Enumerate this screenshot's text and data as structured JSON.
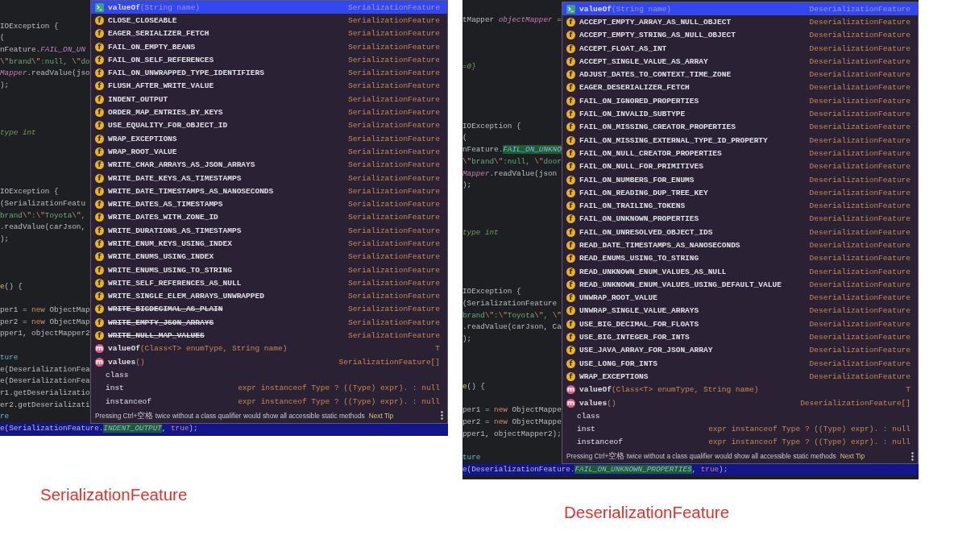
{
  "panels": [
    {
      "editor_lines": [
        {
          "kind": "code",
          "segments": [
            {
              "kind": "plain",
              "text": "IOException {"
            }
          ]
        },
        {
          "kind": "code",
          "segments": [
            {
              "kind": "plain",
              "text": "("
            }
          ]
        },
        {
          "kind": "code",
          "segments": [
            {
              "kind": "plain",
              "text": "nFeature."
            },
            {
              "kind": "field",
              "text": "FAIL_ON_UN"
            }
          ]
        },
        {
          "kind": "code",
          "segments": [
            {
              "kind": "escape",
              "text": "\\\""
            },
            {
              "kind": "string",
              "text": "brand"
            },
            {
              "kind": "escape",
              "text": "\\\""
            },
            {
              "kind": "string",
              "text": ":null, "
            },
            {
              "kind": "escape",
              "text": "\\\""
            },
            {
              "kind": "string",
              "text": "do"
            }
          ]
        },
        {
          "kind": "code",
          "segments": [
            {
              "kind": "field",
              "text": "Mapper"
            },
            {
              "kind": "plain",
              "text": ".readValue(jso"
            }
          ]
        },
        {
          "kind": "code",
          "segments": [
            {
              "kind": "plain",
              "text": ");"
            }
          ]
        },
        {
          "kind": "blank"
        },
        {
          "kind": "blank"
        },
        {
          "kind": "blank"
        },
        {
          "kind": "code",
          "segments": [
            {
              "kind": "comment",
              "text": "type int"
            }
          ]
        },
        {
          "kind": "blank"
        },
        {
          "kind": "blank"
        },
        {
          "kind": "blank"
        },
        {
          "kind": "blank"
        },
        {
          "kind": "code",
          "segments": [
            {
              "kind": "plain",
              "text": "IOException {"
            }
          ]
        },
        {
          "kind": "code",
          "segments": [
            {
              "kind": "plain",
              "text": "(SerializationFeatu"
            }
          ]
        },
        {
          "kind": "code",
          "segments": [
            {
              "kind": "string",
              "text": "brand"
            },
            {
              "kind": "escape",
              "text": "\\\""
            },
            {
              "kind": "string",
              "text": ":"
            },
            {
              "kind": "escape",
              "text": "\\\""
            },
            {
              "kind": "string",
              "text": "Toyota"
            },
            {
              "kind": "escape",
              "text": "\\\""
            },
            {
              "kind": "string",
              "text": ","
            }
          ]
        },
        {
          "kind": "code",
          "segments": [
            {
              "kind": "plain",
              "text": ".readValue(carJson,"
            }
          ]
        },
        {
          "kind": "code",
          "segments": [
            {
              "kind": "plain",
              "text": ");"
            }
          ]
        },
        {
          "kind": "blank"
        },
        {
          "kind": "blank"
        },
        {
          "kind": "blank"
        },
        {
          "kind": "code",
          "segments": [
            {
              "kind": "method",
              "text": "e"
            },
            {
              "kind": "plain",
              "text": "() {"
            }
          ]
        },
        {
          "kind": "blank"
        },
        {
          "kind": "code",
          "segments": [
            {
              "kind": "plain",
              "text": "per1 = "
            },
            {
              "kind": "keyword",
              "text": "new"
            },
            {
              "kind": "plain",
              "text": " ObjectMap"
            }
          ]
        },
        {
          "kind": "code",
          "segments": [
            {
              "kind": "plain",
              "text": "per2 = "
            },
            {
              "kind": "keyword",
              "text": "new"
            },
            {
              "kind": "plain",
              "text": " ObjectMap"
            }
          ]
        },
        {
          "kind": "code",
          "segments": [
            {
              "kind": "plain",
              "text": "pper1, objectMapper2"
            }
          ]
        },
        {
          "kind": "blank"
        },
        {
          "kind": "code",
          "segments": [
            {
              "kind": "teal",
              "text": "ture"
            }
          ]
        },
        {
          "kind": "code",
          "segments": [
            {
              "kind": "plain",
              "text": "e(DeserializationFea"
            }
          ]
        },
        {
          "kind": "code",
          "segments": [
            {
              "kind": "plain",
              "text": "e(DeserializationFea"
            }
          ]
        },
        {
          "kind": "code",
          "segments": [
            {
              "kind": "plain",
              "text": "r1.getDeserializatio"
            }
          ]
        },
        {
          "kind": "code",
          "segments": [
            {
              "kind": "plain",
              "text": "er2.getDeserializati"
            }
          ]
        },
        {
          "kind": "code",
          "segments": [
            {
              "kind": "teal",
              "text": "re"
            }
          ]
        }
      ],
      "current_line": {
        "segments": [
          {
            "kind": "plain",
            "text": "e(SerializationFeature."
          },
          {
            "kind": "match",
            "text": "INDENT_OUTPUT"
          },
          {
            "kind": "plain",
            "text": ", "
          },
          {
            "kind": "keyword",
            "text": "true"
          },
          {
            "kind": "plain",
            "text": ");"
          }
        ]
      },
      "completion": {
        "items": [
          {
            "kind": "static-method",
            "name": "valueOf",
            "params": "(String name)",
            "type": "SerializationFeature",
            "selected": true,
            "deprecated": false
          },
          {
            "kind": "field",
            "icon": "f",
            "name": "CLOSE_CLOSEABLE",
            "type": "SerializationFeature",
            "selected": false,
            "deprecated": false
          },
          {
            "kind": "field",
            "icon": "f",
            "name": "EAGER_SERIALIZER_FETCH",
            "type": "SerializationFeature",
            "selected": false,
            "deprecated": false
          },
          {
            "kind": "field",
            "icon": "f",
            "name": "FAIL_ON_EMPTY_BEANS",
            "type": "SerializationFeature",
            "selected": false,
            "deprecated": false
          },
          {
            "kind": "field",
            "icon": "f",
            "name": "FAIL_ON_SELF_REFERENCES",
            "type": "SerializationFeature",
            "selected": false,
            "deprecated": false
          },
          {
            "kind": "field",
            "icon": "f",
            "name": "FAIL_ON_UNWRAPPED_TYPE_IDENTIFIERS",
            "type": "SerializationFeature",
            "selected": false,
            "deprecated": false
          },
          {
            "kind": "field",
            "icon": "f",
            "name": "FLUSH_AFTER_WRITE_VALUE",
            "type": "SerializationFeature",
            "selected": false,
            "deprecated": false
          },
          {
            "kind": "field",
            "icon": "f",
            "name": "INDENT_OUTPUT",
            "type": "SerializationFeature",
            "selected": false,
            "deprecated": false
          },
          {
            "kind": "field",
            "icon": "f",
            "name": "ORDER_MAP_ENTRIES_BY_KEYS",
            "type": "SerializationFeature",
            "selected": false,
            "deprecated": false
          },
          {
            "kind": "field",
            "icon": "f",
            "name": "USE_EQUALITY_FOR_OBJECT_ID",
            "type": "SerializationFeature",
            "selected": false,
            "deprecated": false
          },
          {
            "kind": "field",
            "icon": "f",
            "name": "WRAP_EXCEPTIONS",
            "type": "SerializationFeature",
            "selected": false,
            "deprecated": false
          },
          {
            "kind": "field",
            "icon": "f",
            "name": "WRAP_ROOT_VALUE",
            "type": "SerializationFeature",
            "selected": false,
            "deprecated": false
          },
          {
            "kind": "field",
            "icon": "f",
            "name": "WRITE_CHAR_ARRAYS_AS_JSON_ARRAYS",
            "type": "SerializationFeature",
            "selected": false,
            "deprecated": false
          },
          {
            "kind": "field",
            "icon": "f",
            "name": "WRITE_DATE_KEYS_AS_TIMESTAMPS",
            "type": "SerializationFeature",
            "selected": false,
            "deprecated": false
          },
          {
            "kind": "field",
            "icon": "f",
            "name": "WRITE_DATE_TIMESTAMPS_AS_NANOSECONDS",
            "type": "SerializationFeature",
            "selected": false,
            "deprecated": false
          },
          {
            "kind": "field",
            "icon": "f",
            "name": "WRITE_DATES_AS_TIMESTAMPS",
            "type": "SerializationFeature",
            "selected": false,
            "deprecated": false
          },
          {
            "kind": "field",
            "icon": "f",
            "name": "WRITE_DATES_WITH_ZONE_ID",
            "type": "SerializationFeature",
            "selected": false,
            "deprecated": false
          },
          {
            "kind": "field",
            "icon": "f",
            "name": "WRITE_DURATIONS_AS_TIMESTAMPS",
            "type": "SerializationFeature",
            "selected": false,
            "deprecated": false
          },
          {
            "kind": "field",
            "icon": "f",
            "name": "WRITE_ENUM_KEYS_USING_INDEX",
            "type": "SerializationFeature",
            "selected": false,
            "deprecated": false
          },
          {
            "kind": "field",
            "icon": "f",
            "name": "WRITE_ENUMS_USING_INDEX",
            "type": "SerializationFeature",
            "selected": false,
            "deprecated": false
          },
          {
            "kind": "field",
            "icon": "f",
            "name": "WRITE_ENUMS_USING_TO_STRING",
            "type": "SerializationFeature",
            "selected": false,
            "deprecated": false
          },
          {
            "kind": "field",
            "icon": "f",
            "name": "WRITE_SELF_REFERENCES_AS_NULL",
            "type": "SerializationFeature",
            "selected": false,
            "deprecated": false
          },
          {
            "kind": "field",
            "icon": "f",
            "name": "WRITE_SINGLE_ELEM_ARRAYS_UNWRAPPED",
            "type": "SerializationFeature",
            "selected": false,
            "deprecated": false
          },
          {
            "kind": "field",
            "icon": "f",
            "name": "WRITE_BIGDECIMAL_AS_PLAIN",
            "type": "SerializationFeature",
            "selected": false,
            "deprecated": true
          },
          {
            "kind": "field",
            "icon": "f",
            "name": "WRITE_EMPTY_JSON_ARRAYS",
            "type": "SerializationFeature",
            "selected": false,
            "deprecated": true
          },
          {
            "kind": "field",
            "icon": "f",
            "name": "WRITE_NULL_MAP_VALUES",
            "type": "SerializationFeature",
            "selected": false,
            "deprecated": true
          },
          {
            "kind": "method",
            "icon": "m",
            "name": "valueOf",
            "params": "(Class<T> enumType, String name)",
            "type": "T",
            "selected": false,
            "deprecated": false
          },
          {
            "kind": "method",
            "icon": "m",
            "name": "values",
            "params": "()",
            "type": "SerializationFeature[]",
            "selected": false,
            "deprecated": false
          },
          {
            "kind": "keyword",
            "name": "class",
            "selected": false,
            "deprecated": false
          },
          {
            "kind": "keyword",
            "name": "inst",
            "type": "expr instanceof Type ? ((Type) expr). : null",
            "selected": false,
            "deprecated": false
          },
          {
            "kind": "keyword",
            "name": "instanceof",
            "type": "expr instanceof Type ? ((Type) expr). : null",
            "selected": false,
            "deprecated": false
          }
        ],
        "hint": "Pressing Ctrl+空格 twice without a class qualifier would show all accessible static methods",
        "hint_link": "Next Tip"
      },
      "caption": "SerializationFeature"
    },
    {
      "editor_lines": [
        {
          "kind": "code",
          "segments": [
            {
              "kind": "plain",
              "text": "tMapper "
            },
            {
              "kind": "field",
              "text": "objectMapper"
            },
            {
              "kind": "plain",
              "text": " ="
            }
          ]
        },
        {
          "kind": "blank"
        },
        {
          "kind": "blank"
        },
        {
          "kind": "blank"
        },
        {
          "kind": "code",
          "segments": [
            {
              "kind": "comment",
              "text": "=0}"
            }
          ]
        },
        {
          "kind": "blank"
        },
        {
          "kind": "blank"
        },
        {
          "kind": "blank"
        },
        {
          "kind": "blank"
        },
        {
          "kind": "code",
          "segments": [
            {
              "kind": "plain",
              "text": "IOException {"
            }
          ]
        },
        {
          "kind": "code",
          "segments": [
            {
              "kind": "plain",
              "text": "("
            }
          ]
        },
        {
          "kind": "code",
          "segments": [
            {
              "kind": "plain",
              "text": "nFeature."
            },
            {
              "kind": "match",
              "text": "FAIL_ON_UNKNO"
            }
          ]
        },
        {
          "kind": "code",
          "segments": [
            {
              "kind": "escape",
              "text": "\\\""
            },
            {
              "kind": "string",
              "text": "brand"
            },
            {
              "kind": "escape",
              "text": "\\\""
            },
            {
              "kind": "string",
              "text": ":null, "
            },
            {
              "kind": "escape",
              "text": "\\\""
            },
            {
              "kind": "string",
              "text": "door"
            }
          ]
        },
        {
          "kind": "code",
          "segments": [
            {
              "kind": "field",
              "text": "Mapper"
            },
            {
              "kind": "plain",
              "text": ".readValue(json"
            }
          ]
        },
        {
          "kind": "code",
          "segments": [
            {
              "kind": "plain",
              "text": ");"
            }
          ]
        },
        {
          "kind": "blank"
        },
        {
          "kind": "blank"
        },
        {
          "kind": "blank"
        },
        {
          "kind": "code",
          "segments": [
            {
              "kind": "comment",
              "text": "type int"
            }
          ]
        },
        {
          "kind": "blank"
        },
        {
          "kind": "blank"
        },
        {
          "kind": "blank"
        },
        {
          "kind": "blank"
        },
        {
          "kind": "code",
          "segments": [
            {
              "kind": "plain",
              "text": "IOException {"
            }
          ]
        },
        {
          "kind": "code",
          "segments": [
            {
              "kind": "plain",
              "text": "(SerializationFeature"
            }
          ]
        },
        {
          "kind": "code",
          "segments": [
            {
              "kind": "string",
              "text": "brand"
            },
            {
              "kind": "escape",
              "text": "\\\""
            },
            {
              "kind": "string",
              "text": ":"
            },
            {
              "kind": "escape",
              "text": "\\\""
            },
            {
              "kind": "string",
              "text": "Toyota"
            },
            {
              "kind": "escape",
              "text": "\\\""
            },
            {
              "kind": "string",
              "text": ", "
            },
            {
              "kind": "escape",
              "text": "\\\""
            }
          ]
        },
        {
          "kind": "code",
          "segments": [
            {
              "kind": "plain",
              "text": ".readValue(carJson, Ca"
            }
          ]
        },
        {
          "kind": "code",
          "segments": [
            {
              "kind": "plain",
              "text": ");"
            }
          ]
        },
        {
          "kind": "blank"
        },
        {
          "kind": "blank"
        },
        {
          "kind": "blank"
        },
        {
          "kind": "code",
          "segments": [
            {
              "kind": "method",
              "text": "e"
            },
            {
              "kind": "plain",
              "text": "() {"
            }
          ]
        },
        {
          "kind": "blank"
        },
        {
          "kind": "code",
          "segments": [
            {
              "kind": "plain",
              "text": "per1 = "
            },
            {
              "kind": "keyword",
              "text": "new"
            },
            {
              "kind": "plain",
              "text": " ObjectMappe"
            }
          ]
        },
        {
          "kind": "code",
          "segments": [
            {
              "kind": "plain",
              "text": "per2 = "
            },
            {
              "kind": "keyword",
              "text": "new"
            },
            {
              "kind": "plain",
              "text": " ObjectMappe"
            }
          ]
        },
        {
          "kind": "code",
          "segments": [
            {
              "kind": "plain",
              "text": "pper1, objectMapper2);"
            }
          ]
        },
        {
          "kind": "blank"
        },
        {
          "kind": "code",
          "segments": [
            {
              "kind": "teal",
              "text": "ture"
            }
          ]
        }
      ],
      "current_line": {
        "segments": [
          {
            "kind": "plain",
            "text": "e(DeserializationFeature."
          },
          {
            "kind": "match",
            "text": "FAIL_ON_UNKNOWN_PROPERTIES"
          },
          {
            "kind": "plain",
            "text": ", "
          },
          {
            "kind": "keyword",
            "text": "true"
          },
          {
            "kind": "plain",
            "text": ");"
          }
        ]
      },
      "completion": {
        "items": [
          {
            "kind": "static-method",
            "name": "valueOf",
            "params": "(String name)",
            "type": "DeserializationFeature",
            "selected": true,
            "deprecated": false
          },
          {
            "kind": "field",
            "icon": "f",
            "name": "ACCEPT_EMPTY_ARRAY_AS_NULL_OBJECT",
            "type": "DeserializationFeature",
            "selected": false,
            "deprecated": false
          },
          {
            "kind": "field",
            "icon": "f",
            "name": "ACCEPT_EMPTY_STRING_AS_NULL_OBJECT",
            "type": "DeserializationFeature",
            "selected": false,
            "deprecated": false
          },
          {
            "kind": "field",
            "icon": "f",
            "name": "ACCEPT_FLOAT_AS_INT",
            "type": "DeserializationFeature",
            "selected": false,
            "deprecated": false
          },
          {
            "kind": "field",
            "icon": "f",
            "name": "ACCEPT_SINGLE_VALUE_AS_ARRAY",
            "type": "DeserializationFeature",
            "selected": false,
            "deprecated": false
          },
          {
            "kind": "field",
            "icon": "f",
            "name": "ADJUST_DATES_TO_CONTEXT_TIME_ZONE",
            "type": "DeserializationFeature",
            "selected": false,
            "deprecated": false
          },
          {
            "kind": "field",
            "icon": "f",
            "name": "EAGER_DESERIALIZER_FETCH",
            "type": "DeserializationFeature",
            "selected": false,
            "deprecated": false
          },
          {
            "kind": "field",
            "icon": "f",
            "name": "FAIL_ON_IGNORED_PROPERTIES",
            "type": "DeserializationFeature",
            "selected": false,
            "deprecated": false
          },
          {
            "kind": "field",
            "icon": "f",
            "name": "FAIL_ON_INVALID_SUBTYPE",
            "type": "DeserializationFeature",
            "selected": false,
            "deprecated": false
          },
          {
            "kind": "field",
            "icon": "f",
            "name": "FAIL_ON_MISSING_CREATOR_PROPERTIES",
            "type": "DeserializationFeature",
            "selected": false,
            "deprecated": false
          },
          {
            "kind": "field",
            "icon": "f",
            "name": "FAIL_ON_MISSING_EXTERNAL_TYPE_ID_PROPERTY",
            "type": "DeserializationFeature",
            "selected": false,
            "deprecated": false
          },
          {
            "kind": "field",
            "icon": "f",
            "name": "FAIL_ON_NULL_CREATOR_PROPERTIES",
            "type": "DeserializationFeature",
            "selected": false,
            "deprecated": false
          },
          {
            "kind": "field",
            "icon": "f",
            "name": "FAIL_ON_NULL_FOR_PRIMITIVES",
            "type": "DeserializationFeature",
            "selected": false,
            "deprecated": false
          },
          {
            "kind": "field",
            "icon": "f",
            "name": "FAIL_ON_NUMBERS_FOR_ENUMS",
            "type": "DeserializationFeature",
            "selected": false,
            "deprecated": false
          },
          {
            "kind": "field",
            "icon": "f",
            "name": "FAIL_ON_READING_DUP_TREE_KEY",
            "type": "DeserializationFeature",
            "selected": false,
            "deprecated": false
          },
          {
            "kind": "field",
            "icon": "f",
            "name": "FAIL_ON_TRAILING_TOKENS",
            "type": "DeserializationFeature",
            "selected": false,
            "deprecated": false
          },
          {
            "kind": "field",
            "icon": "f",
            "name": "FAIL_ON_UNKNOWN_PROPERTIES",
            "type": "DeserializationFeature",
            "selected": false,
            "deprecated": false
          },
          {
            "kind": "field",
            "icon": "f",
            "name": "FAIL_ON_UNRESOLVED_OBJECT_IDS",
            "type": "DeserializationFeature",
            "selected": false,
            "deprecated": false
          },
          {
            "kind": "field",
            "icon": "f",
            "name": "READ_DATE_TIMESTAMPS_AS_NANOSECONDS",
            "type": "DeserializationFeature",
            "selected": false,
            "deprecated": false
          },
          {
            "kind": "field",
            "icon": "f",
            "name": "READ_ENUMS_USING_TO_STRING",
            "type": "DeserializationFeature",
            "selected": false,
            "deprecated": false
          },
          {
            "kind": "field",
            "icon": "f",
            "name": "READ_UNKNOWN_ENUM_VALUES_AS_NULL",
            "type": "DeserializationFeature",
            "selected": false,
            "deprecated": false
          },
          {
            "kind": "field",
            "icon": "f",
            "name": "READ_UNKNOWN_ENUM_VALUES_USING_DEFAULT_VALUE",
            "type": "DeserializationFeature",
            "selected": false,
            "deprecated": false
          },
          {
            "kind": "field",
            "icon": "f",
            "name": "UNWRAP_ROOT_VALUE",
            "type": "DeserializationFeature",
            "selected": false,
            "deprecated": false
          },
          {
            "kind": "field",
            "icon": "f",
            "name": "UNWRAP_SINGLE_VALUE_ARRAYS",
            "type": "DeserializationFeature",
            "selected": false,
            "deprecated": false
          },
          {
            "kind": "field",
            "icon": "f",
            "name": "USE_BIG_DECIMAL_FOR_FLOATS",
            "type": "DeserializationFeature",
            "selected": false,
            "deprecated": false
          },
          {
            "kind": "field",
            "icon": "f",
            "name": "USE_BIG_INTEGER_FOR_INTS",
            "type": "DeserializationFeature",
            "selected": false,
            "deprecated": false
          },
          {
            "kind": "field",
            "icon": "f",
            "name": "USE_JAVA_ARRAY_FOR_JSON_ARRAY",
            "type": "DeserializationFeature",
            "selected": false,
            "deprecated": false
          },
          {
            "kind": "field",
            "icon": "f",
            "name": "USE_LONG_FOR_INTS",
            "type": "DeserializationFeature",
            "selected": false,
            "deprecated": false
          },
          {
            "kind": "field",
            "icon": "f",
            "name": "WRAP_EXCEPTIONS",
            "type": "DeserializationFeature",
            "selected": false,
            "deprecated": false
          },
          {
            "kind": "method",
            "icon": "m",
            "name": "valueOf",
            "params": "(Class<T> enumType, String name)",
            "type": "T",
            "selected": false,
            "deprecated": false
          },
          {
            "kind": "method",
            "icon": "m",
            "name": "values",
            "params": "()",
            "type": "DeserializationFeature[]",
            "selected": false,
            "deprecated": false
          },
          {
            "kind": "keyword",
            "name": "class",
            "selected": false,
            "deprecated": false
          },
          {
            "kind": "keyword",
            "name": "inst",
            "type": "expr instanceof Type ? ((Type) expr). : null",
            "selected": false,
            "deprecated": false
          },
          {
            "kind": "keyword",
            "name": "instanceof",
            "type": "expr instanceof Type ? ((Type) expr). : null",
            "selected": false,
            "deprecated": false
          }
        ],
        "hint": "Pressing Ctrl+空格 twice without a class qualifier would show all accessible static methods",
        "hint_link": "Next Tip"
      },
      "caption": "DeserializationFeature"
    }
  ]
}
